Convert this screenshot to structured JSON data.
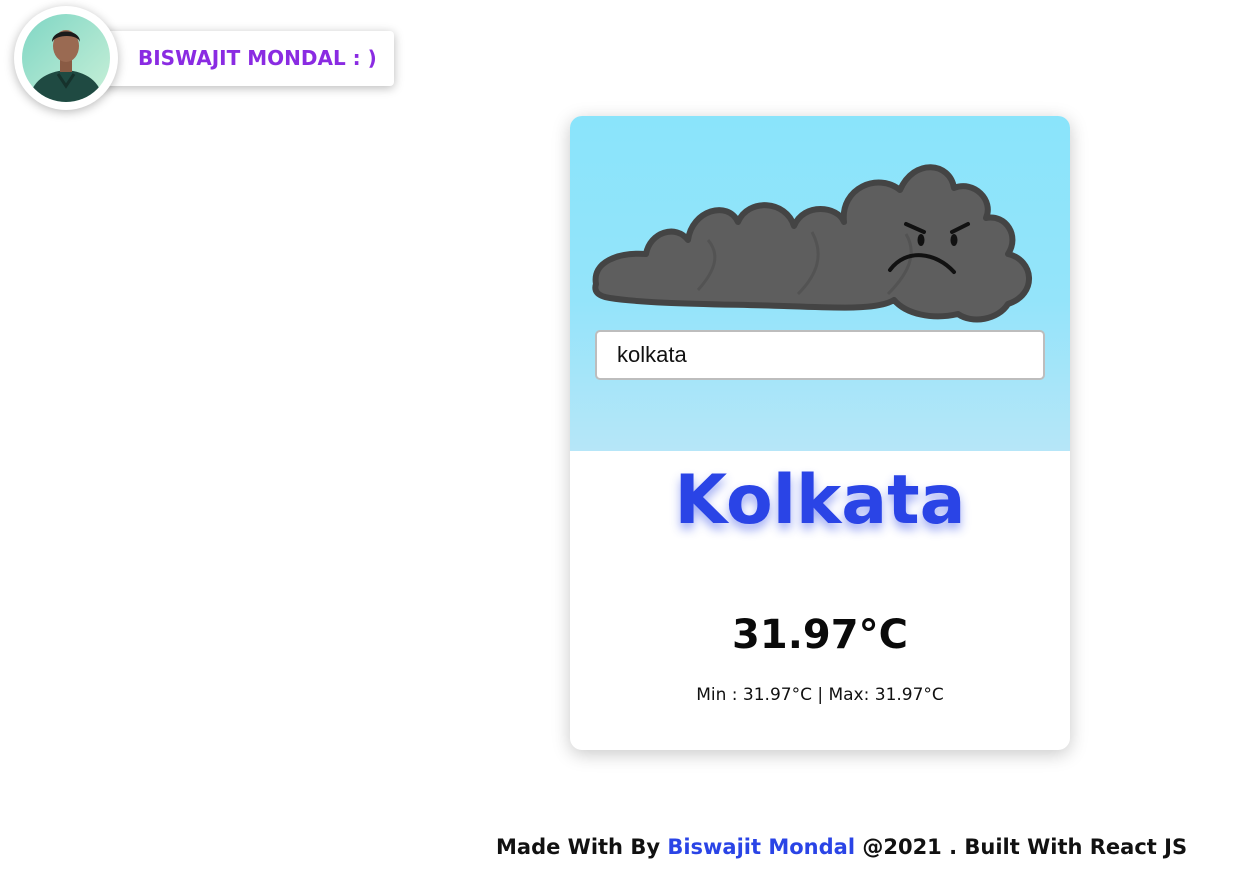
{
  "profile": {
    "name": "BISWAJIT MONDAL : )"
  },
  "card": {
    "search": {
      "value": "kolkata"
    },
    "city": "Kolkata",
    "temperature": "31.97°C",
    "minmax": "Min : 31.97°C | Max: 31.97°C"
  },
  "footer": {
    "prefix": "Made With By ",
    "author": "Biswajit Mondal",
    "suffix": " @2021 . Built With React JS"
  },
  "colors": {
    "accent_blue": "#2a44e6",
    "name_purple": "#8a2be2",
    "sky_top": "#8ae4fb",
    "sky_bottom": "#b6e6f8",
    "cloud_gray": "#5e5e5e"
  },
  "icons": {
    "avatar": "profile-photo",
    "weather": "angry-cloud-icon"
  }
}
